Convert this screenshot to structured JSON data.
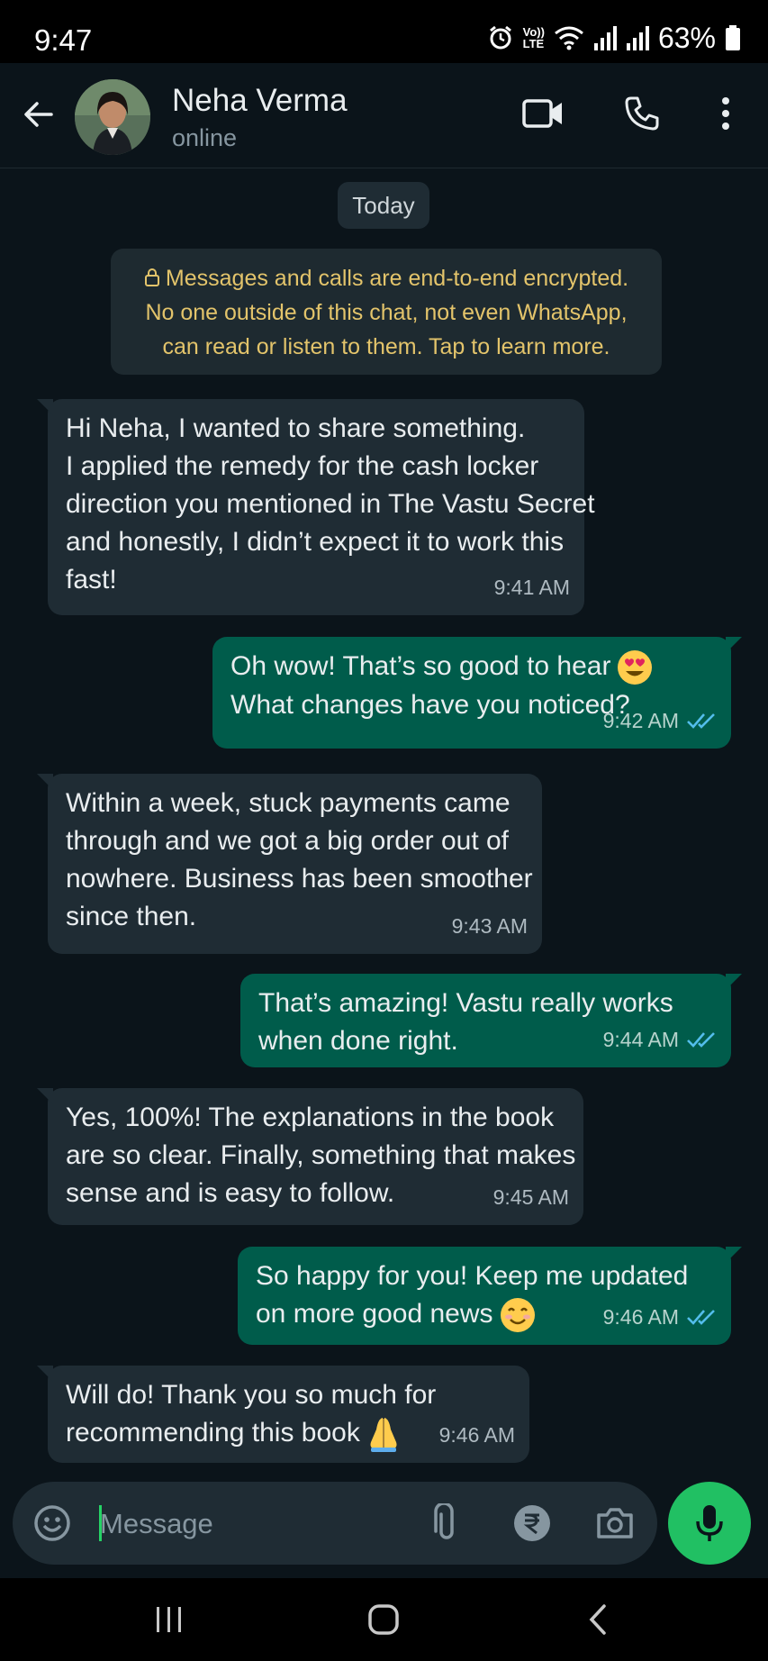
{
  "status_bar": {
    "time": "9:47",
    "network_label": "LTE",
    "volte_label": "Vo))",
    "battery": "63%"
  },
  "header": {
    "contact_name": "Neha Verma",
    "contact_status": "online"
  },
  "chat": {
    "date_chip": "Today",
    "encryption_notice": [
      "Messages and calls are end-to-end encrypted.",
      "No one outside of this chat, not even WhatsApp,",
      "can read or listen to them. Tap to learn more."
    ],
    "messages": [
      {
        "direction": "incoming",
        "lines": [
          "Hi Neha, I wanted to share something.",
          "I applied the remedy for the cash locker",
          "direction you mentioned in The Vastu Secret",
          "and honestly, I didn’t expect it to work this",
          "fast!"
        ],
        "time": "9:41 AM"
      },
      {
        "direction": "outgoing",
        "lines": [
          "Oh wow! That’s so good to hear",
          "What changes have you noticed?"
        ],
        "time": "9:42 AM",
        "emoji": "heart-eyes"
      },
      {
        "direction": "incoming",
        "lines": [
          "Within a week, stuck payments came",
          "through and we got a big order out of",
          "nowhere. Business has been smoother",
          "since then."
        ],
        "time": "9:43 AM"
      },
      {
        "direction": "outgoing",
        "lines": [
          "That’s amazing! Vastu really works",
          "when done right."
        ],
        "time": "9:44 AM"
      },
      {
        "direction": "incoming",
        "lines": [
          "Yes, 100%! The explanations in the book",
          "are so clear. Finally, something that makes",
          "sense and is easy to follow."
        ],
        "time": "9:45 AM"
      },
      {
        "direction": "outgoing",
        "lines": [
          "So happy for you! Keep me updated",
          "on more good news"
        ],
        "time": "9:46 AM",
        "emoji": "smiling-face"
      },
      {
        "direction": "incoming",
        "lines": [
          "Will do! Thank you so much for",
          "recommending this book"
        ],
        "time": "9:46 AM",
        "emoji": "folded-hands"
      }
    ]
  },
  "input": {
    "placeholder": "Message"
  },
  "colors": {
    "background": "#0b141a",
    "incoming_bubble": "#1f2c34",
    "outgoing_bubble": "#005c4b",
    "accent_green": "#21c063",
    "read_tick": "#53bdeb",
    "encryption_text": "#e3c46b"
  },
  "icons": {
    "header": [
      "back-arrow-icon",
      "video-call-icon",
      "voice-call-icon",
      "more-options-icon"
    ],
    "input": [
      "emoji-icon",
      "attach-icon",
      "rupee-payment-icon",
      "camera-icon",
      "mic-icon"
    ],
    "navbar": [
      "recent-apps-icon",
      "home-icon",
      "back-icon"
    ]
  }
}
